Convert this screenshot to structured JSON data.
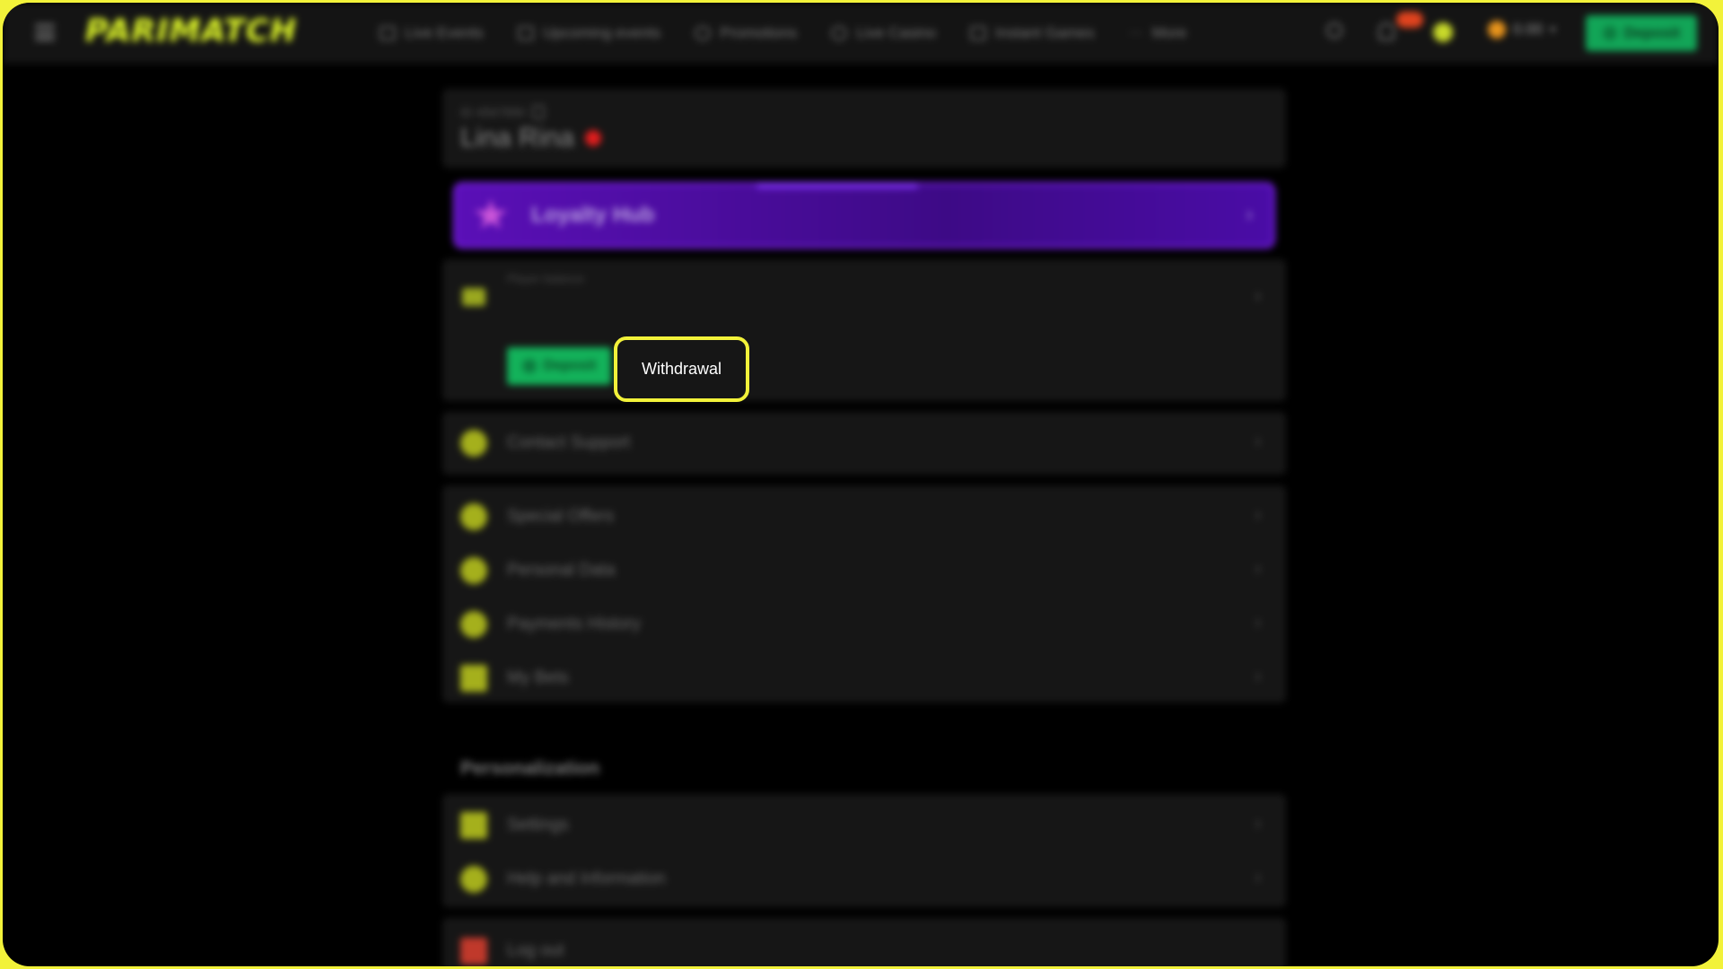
{
  "header": {
    "logo": "PARIMATCH",
    "nav": [
      {
        "label": "Live Events",
        "icon": "live-icon"
      },
      {
        "label": "Upcoming events",
        "icon": "calendar-icon"
      },
      {
        "label": "Promotions",
        "icon": "gift-icon"
      },
      {
        "label": "Live Casino",
        "icon": "casino-icon"
      },
      {
        "label": "Instant Games",
        "icon": "rocket-icon"
      },
      {
        "label": "More",
        "icon": "more-dots-icon"
      }
    ],
    "balance": "0.00",
    "deposit_label": "Deposit"
  },
  "profile": {
    "id_label": "ID 4567890",
    "name": "Lina Rina"
  },
  "loyalty": {
    "label": "Loyalty Hub"
  },
  "balance_card": {
    "title": "Player balance",
    "deposit_label": "Deposit",
    "withdrawal_label": "Withdrawal"
  },
  "menu": {
    "contact": "Contact Support",
    "special_offers": "Special Offers",
    "personal_data": "Personal Data",
    "payments_history": "Payments History",
    "my_bets": "My Bets"
  },
  "personalization": {
    "title": "Personalization",
    "settings": "Settings",
    "help": "Help and Information"
  },
  "logout": "Log out",
  "colors": {
    "accent": "#e6ff2a",
    "focus_ring": "#f2f23a",
    "deposit_green": "#13b25a",
    "loyalty_purple": "#5a0fb7"
  }
}
